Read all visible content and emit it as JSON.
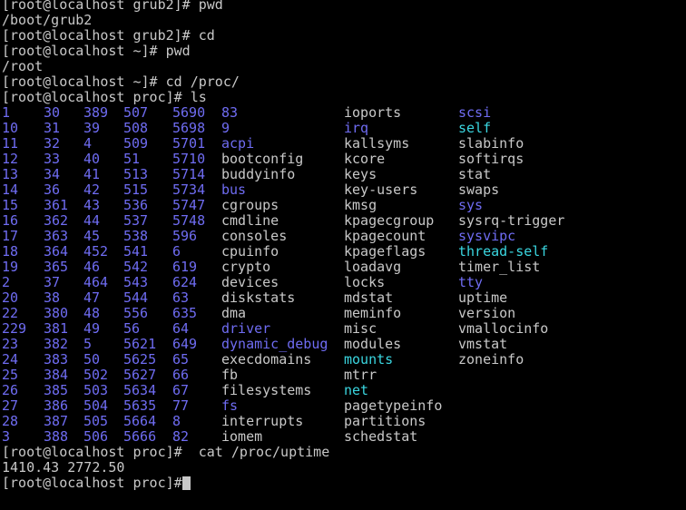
{
  "colors": {
    "background": "#000000",
    "text": "#c8c8c8",
    "directory": "#6f6cf2",
    "symlink": "#3ad6e0"
  },
  "history": [
    "[root@localhost grub2]# pwd",
    "/boot/grub2",
    "[root@localhost grub2]# cd",
    "[root@localhost ~]# pwd",
    "/root",
    "[root@localhost ~]# cd /proc/",
    "[root@localhost proc]# ls"
  ],
  "ls_rows": [
    [
      {
        "t": "1",
        "k": "dir"
      },
      {
        "t": "30",
        "k": "dir"
      },
      {
        "t": "389",
        "k": "dir"
      },
      {
        "t": "507",
        "k": "dir"
      },
      {
        "t": "5690",
        "k": "dir"
      },
      {
        "t": "83",
        "k": "dir"
      },
      {
        "t": "ioports",
        "k": "file"
      },
      {
        "t": "scsi",
        "k": "dir"
      }
    ],
    [
      {
        "t": "10",
        "k": "dir"
      },
      {
        "t": "31",
        "k": "dir"
      },
      {
        "t": "39",
        "k": "dir"
      },
      {
        "t": "508",
        "k": "dir"
      },
      {
        "t": "5698",
        "k": "dir"
      },
      {
        "t": "9",
        "k": "dir"
      },
      {
        "t": "irq",
        "k": "dir"
      },
      {
        "t": "self",
        "k": "link"
      }
    ],
    [
      {
        "t": "11",
        "k": "dir"
      },
      {
        "t": "32",
        "k": "dir"
      },
      {
        "t": "4",
        "k": "dir"
      },
      {
        "t": "509",
        "k": "dir"
      },
      {
        "t": "5701",
        "k": "dir"
      },
      {
        "t": "acpi",
        "k": "dir"
      },
      {
        "t": "kallsyms",
        "k": "file"
      },
      {
        "t": "slabinfo",
        "k": "file"
      }
    ],
    [
      {
        "t": "12",
        "k": "dir"
      },
      {
        "t": "33",
        "k": "dir"
      },
      {
        "t": "40",
        "k": "dir"
      },
      {
        "t": "51",
        "k": "dir"
      },
      {
        "t": "5710",
        "k": "dir"
      },
      {
        "t": "bootconfig",
        "k": "file"
      },
      {
        "t": "kcore",
        "k": "file"
      },
      {
        "t": "softirqs",
        "k": "file"
      }
    ],
    [
      {
        "t": "13",
        "k": "dir"
      },
      {
        "t": "34",
        "k": "dir"
      },
      {
        "t": "41",
        "k": "dir"
      },
      {
        "t": "513",
        "k": "dir"
      },
      {
        "t": "5714",
        "k": "dir"
      },
      {
        "t": "buddyinfo",
        "k": "file"
      },
      {
        "t": "keys",
        "k": "file"
      },
      {
        "t": "stat",
        "k": "file"
      }
    ],
    [
      {
        "t": "14",
        "k": "dir"
      },
      {
        "t": "36",
        "k": "dir"
      },
      {
        "t": "42",
        "k": "dir"
      },
      {
        "t": "515",
        "k": "dir"
      },
      {
        "t": "5734",
        "k": "dir"
      },
      {
        "t": "bus",
        "k": "dir"
      },
      {
        "t": "key-users",
        "k": "file"
      },
      {
        "t": "swaps",
        "k": "file"
      }
    ],
    [
      {
        "t": "15",
        "k": "dir"
      },
      {
        "t": "361",
        "k": "dir"
      },
      {
        "t": "43",
        "k": "dir"
      },
      {
        "t": "536",
        "k": "dir"
      },
      {
        "t": "5747",
        "k": "dir"
      },
      {
        "t": "cgroups",
        "k": "file"
      },
      {
        "t": "kmsg",
        "k": "file"
      },
      {
        "t": "sys",
        "k": "dir"
      }
    ],
    [
      {
        "t": "16",
        "k": "dir"
      },
      {
        "t": "362",
        "k": "dir"
      },
      {
        "t": "44",
        "k": "dir"
      },
      {
        "t": "537",
        "k": "dir"
      },
      {
        "t": "5748",
        "k": "dir"
      },
      {
        "t": "cmdline",
        "k": "file"
      },
      {
        "t": "kpagecgroup",
        "k": "file"
      },
      {
        "t": "sysrq-trigger",
        "k": "file"
      }
    ],
    [
      {
        "t": "17",
        "k": "dir"
      },
      {
        "t": "363",
        "k": "dir"
      },
      {
        "t": "45",
        "k": "dir"
      },
      {
        "t": "538",
        "k": "dir"
      },
      {
        "t": "596",
        "k": "dir"
      },
      {
        "t": "consoles",
        "k": "file"
      },
      {
        "t": "kpagecount",
        "k": "file"
      },
      {
        "t": "sysvipc",
        "k": "dir"
      }
    ],
    [
      {
        "t": "18",
        "k": "dir"
      },
      {
        "t": "364",
        "k": "dir"
      },
      {
        "t": "452",
        "k": "dir"
      },
      {
        "t": "541",
        "k": "dir"
      },
      {
        "t": "6",
        "k": "dir"
      },
      {
        "t": "cpuinfo",
        "k": "file"
      },
      {
        "t": "kpageflags",
        "k": "file"
      },
      {
        "t": "thread-self",
        "k": "link"
      }
    ],
    [
      {
        "t": "19",
        "k": "dir"
      },
      {
        "t": "365",
        "k": "dir"
      },
      {
        "t": "46",
        "k": "dir"
      },
      {
        "t": "542",
        "k": "dir"
      },
      {
        "t": "619",
        "k": "dir"
      },
      {
        "t": "crypto",
        "k": "file"
      },
      {
        "t": "loadavg",
        "k": "file"
      },
      {
        "t": "timer_list",
        "k": "file"
      }
    ],
    [
      {
        "t": "2",
        "k": "dir"
      },
      {
        "t": "37",
        "k": "dir"
      },
      {
        "t": "464",
        "k": "dir"
      },
      {
        "t": "543",
        "k": "dir"
      },
      {
        "t": "624",
        "k": "dir"
      },
      {
        "t": "devices",
        "k": "file"
      },
      {
        "t": "locks",
        "k": "file"
      },
      {
        "t": "tty",
        "k": "dir"
      }
    ],
    [
      {
        "t": "20",
        "k": "dir"
      },
      {
        "t": "38",
        "k": "dir"
      },
      {
        "t": "47",
        "k": "dir"
      },
      {
        "t": "544",
        "k": "dir"
      },
      {
        "t": "63",
        "k": "dir"
      },
      {
        "t": "diskstats",
        "k": "file"
      },
      {
        "t": "mdstat",
        "k": "file"
      },
      {
        "t": "uptime",
        "k": "file"
      }
    ],
    [
      {
        "t": "22",
        "k": "dir"
      },
      {
        "t": "380",
        "k": "dir"
      },
      {
        "t": "48",
        "k": "dir"
      },
      {
        "t": "556",
        "k": "dir"
      },
      {
        "t": "635",
        "k": "dir"
      },
      {
        "t": "dma",
        "k": "file"
      },
      {
        "t": "meminfo",
        "k": "file"
      },
      {
        "t": "version",
        "k": "file"
      }
    ],
    [
      {
        "t": "229",
        "k": "dir"
      },
      {
        "t": "381",
        "k": "dir"
      },
      {
        "t": "49",
        "k": "dir"
      },
      {
        "t": "56",
        "k": "dir"
      },
      {
        "t": "64",
        "k": "dir"
      },
      {
        "t": "driver",
        "k": "dir"
      },
      {
        "t": "misc",
        "k": "file"
      },
      {
        "t": "vmallocinfo",
        "k": "file"
      }
    ],
    [
      {
        "t": "23",
        "k": "dir"
      },
      {
        "t": "382",
        "k": "dir"
      },
      {
        "t": "5",
        "k": "dir"
      },
      {
        "t": "5621",
        "k": "dir"
      },
      {
        "t": "649",
        "k": "dir"
      },
      {
        "t": "dynamic_debug",
        "k": "dir"
      },
      {
        "t": "modules",
        "k": "file"
      },
      {
        "t": "vmstat",
        "k": "file"
      }
    ],
    [
      {
        "t": "24",
        "k": "dir"
      },
      {
        "t": "383",
        "k": "dir"
      },
      {
        "t": "50",
        "k": "dir"
      },
      {
        "t": "5625",
        "k": "dir"
      },
      {
        "t": "65",
        "k": "dir"
      },
      {
        "t": "execdomains",
        "k": "file"
      },
      {
        "t": "mounts",
        "k": "link"
      },
      {
        "t": "zoneinfo",
        "k": "file"
      }
    ],
    [
      {
        "t": "25",
        "k": "dir"
      },
      {
        "t": "384",
        "k": "dir"
      },
      {
        "t": "502",
        "k": "dir"
      },
      {
        "t": "5627",
        "k": "dir"
      },
      {
        "t": "66",
        "k": "dir"
      },
      {
        "t": "fb",
        "k": "file"
      },
      {
        "t": "mtrr",
        "k": "file"
      },
      {
        "t": "",
        "k": "file"
      }
    ],
    [
      {
        "t": "26",
        "k": "dir"
      },
      {
        "t": "385",
        "k": "dir"
      },
      {
        "t": "503",
        "k": "dir"
      },
      {
        "t": "5634",
        "k": "dir"
      },
      {
        "t": "67",
        "k": "dir"
      },
      {
        "t": "filesystems",
        "k": "file"
      },
      {
        "t": "net",
        "k": "link"
      },
      {
        "t": "",
        "k": "file"
      }
    ],
    [
      {
        "t": "27",
        "k": "dir"
      },
      {
        "t": "386",
        "k": "dir"
      },
      {
        "t": "504",
        "k": "dir"
      },
      {
        "t": "5635",
        "k": "dir"
      },
      {
        "t": "77",
        "k": "dir"
      },
      {
        "t": "fs",
        "k": "dir"
      },
      {
        "t": "pagetypeinfo",
        "k": "file"
      },
      {
        "t": "",
        "k": "file"
      }
    ],
    [
      {
        "t": "28",
        "k": "dir"
      },
      {
        "t": "387",
        "k": "dir"
      },
      {
        "t": "505",
        "k": "dir"
      },
      {
        "t": "5664",
        "k": "dir"
      },
      {
        "t": "8",
        "k": "dir"
      },
      {
        "t": "interrupts",
        "k": "file"
      },
      {
        "t": "partitions",
        "k": "file"
      },
      {
        "t": "",
        "k": "file"
      }
    ],
    [
      {
        "t": "3",
        "k": "dir"
      },
      {
        "t": "388",
        "k": "dir"
      },
      {
        "t": "506",
        "k": "dir"
      },
      {
        "t": "5666",
        "k": "dir"
      },
      {
        "t": "82",
        "k": "dir"
      },
      {
        "t": "iomem",
        "k": "file"
      },
      {
        "t": "schedstat",
        "k": "file"
      },
      {
        "t": "",
        "k": "file"
      }
    ]
  ],
  "after": [
    "[root@localhost proc]#  cat /proc/uptime",
    "1410.43 2772.50"
  ],
  "prompt": "[root@localhost proc]#"
}
